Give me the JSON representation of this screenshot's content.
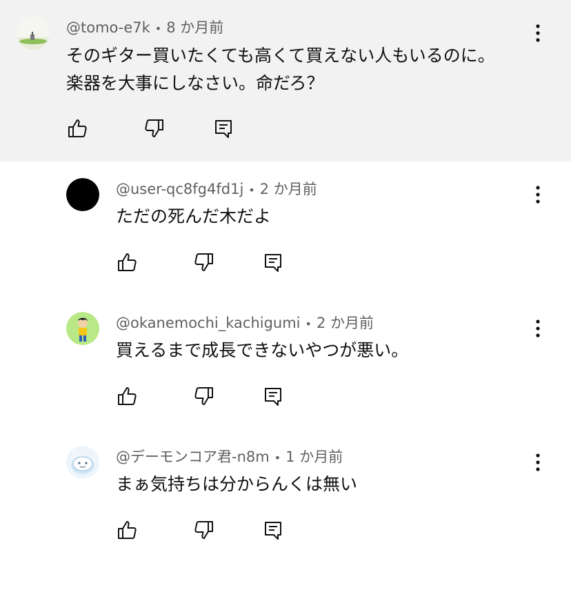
{
  "comments": [
    {
      "author": "@tomo-e7k",
      "time": "8 か月前",
      "lines": [
        "そのギター買いたくても高くて買えない人もいるのに。",
        "楽器を大事にしなさい。命だろ？"
      ],
      "avatar": "landscape-avatar"
    },
    {
      "author": "@user-qc8fg4fd1j",
      "time": "2 か月前",
      "lines": [
        "ただの死んだ木だよ"
      ],
      "avatar": "black-circle-avatar"
    },
    {
      "author": "@okanemochi_kachigumi",
      "time": "2 か月前",
      "lines": [
        "買えるまで成長できないやつが悪い。"
      ],
      "avatar": "cartoon-boy-avatar"
    },
    {
      "author": "@デーモンコア君-n8m",
      "time": "1 か月前",
      "lines": [
        "まぁ気持ちは分からんくは無い"
      ],
      "avatar": "blue-blob-avatar"
    }
  ],
  "separator": "•",
  "colors": {
    "highlight_bg": "#f2f2f2",
    "meta_text": "#606060",
    "body_text": "#0f0f0f"
  }
}
